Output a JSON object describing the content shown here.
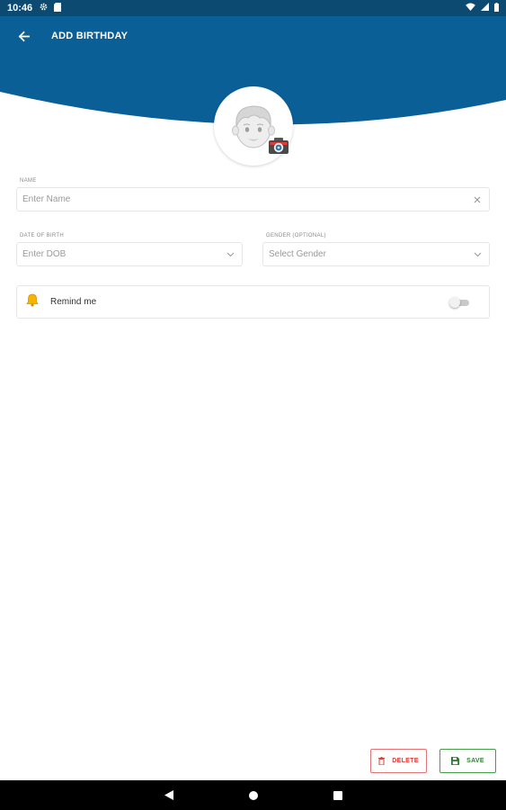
{
  "status_bar": {
    "time": "10:46",
    "left_icons": [
      "gear-icon",
      "sd-card-icon"
    ],
    "right_icons": [
      "wifi-icon",
      "signal-icon",
      "battery-icon"
    ]
  },
  "toolbar": {
    "title": "ADD BIRTHDAY",
    "back_icon": "arrow-left-icon"
  },
  "avatar": {
    "icon": "boy-face-icon",
    "camera_icon": "camera-icon"
  },
  "form": {
    "name": {
      "label": "NAME",
      "placeholder": "Enter Name",
      "value": ""
    },
    "dob": {
      "label": "DATE OF BIRTH",
      "placeholder": "Enter DOB"
    },
    "gender": {
      "label": "GENDER (OPTIONAL)",
      "placeholder": "Select Gender"
    }
  },
  "reminder": {
    "label": "Remind me",
    "enabled": false,
    "icon": "bell-icon"
  },
  "actions": {
    "delete_label": "DELETE",
    "save_label": "SAVE"
  },
  "colors": {
    "header": "#0a5f97",
    "status_bar": "#0c4a72",
    "delete": "#e53935",
    "save": "#2e7d32"
  }
}
